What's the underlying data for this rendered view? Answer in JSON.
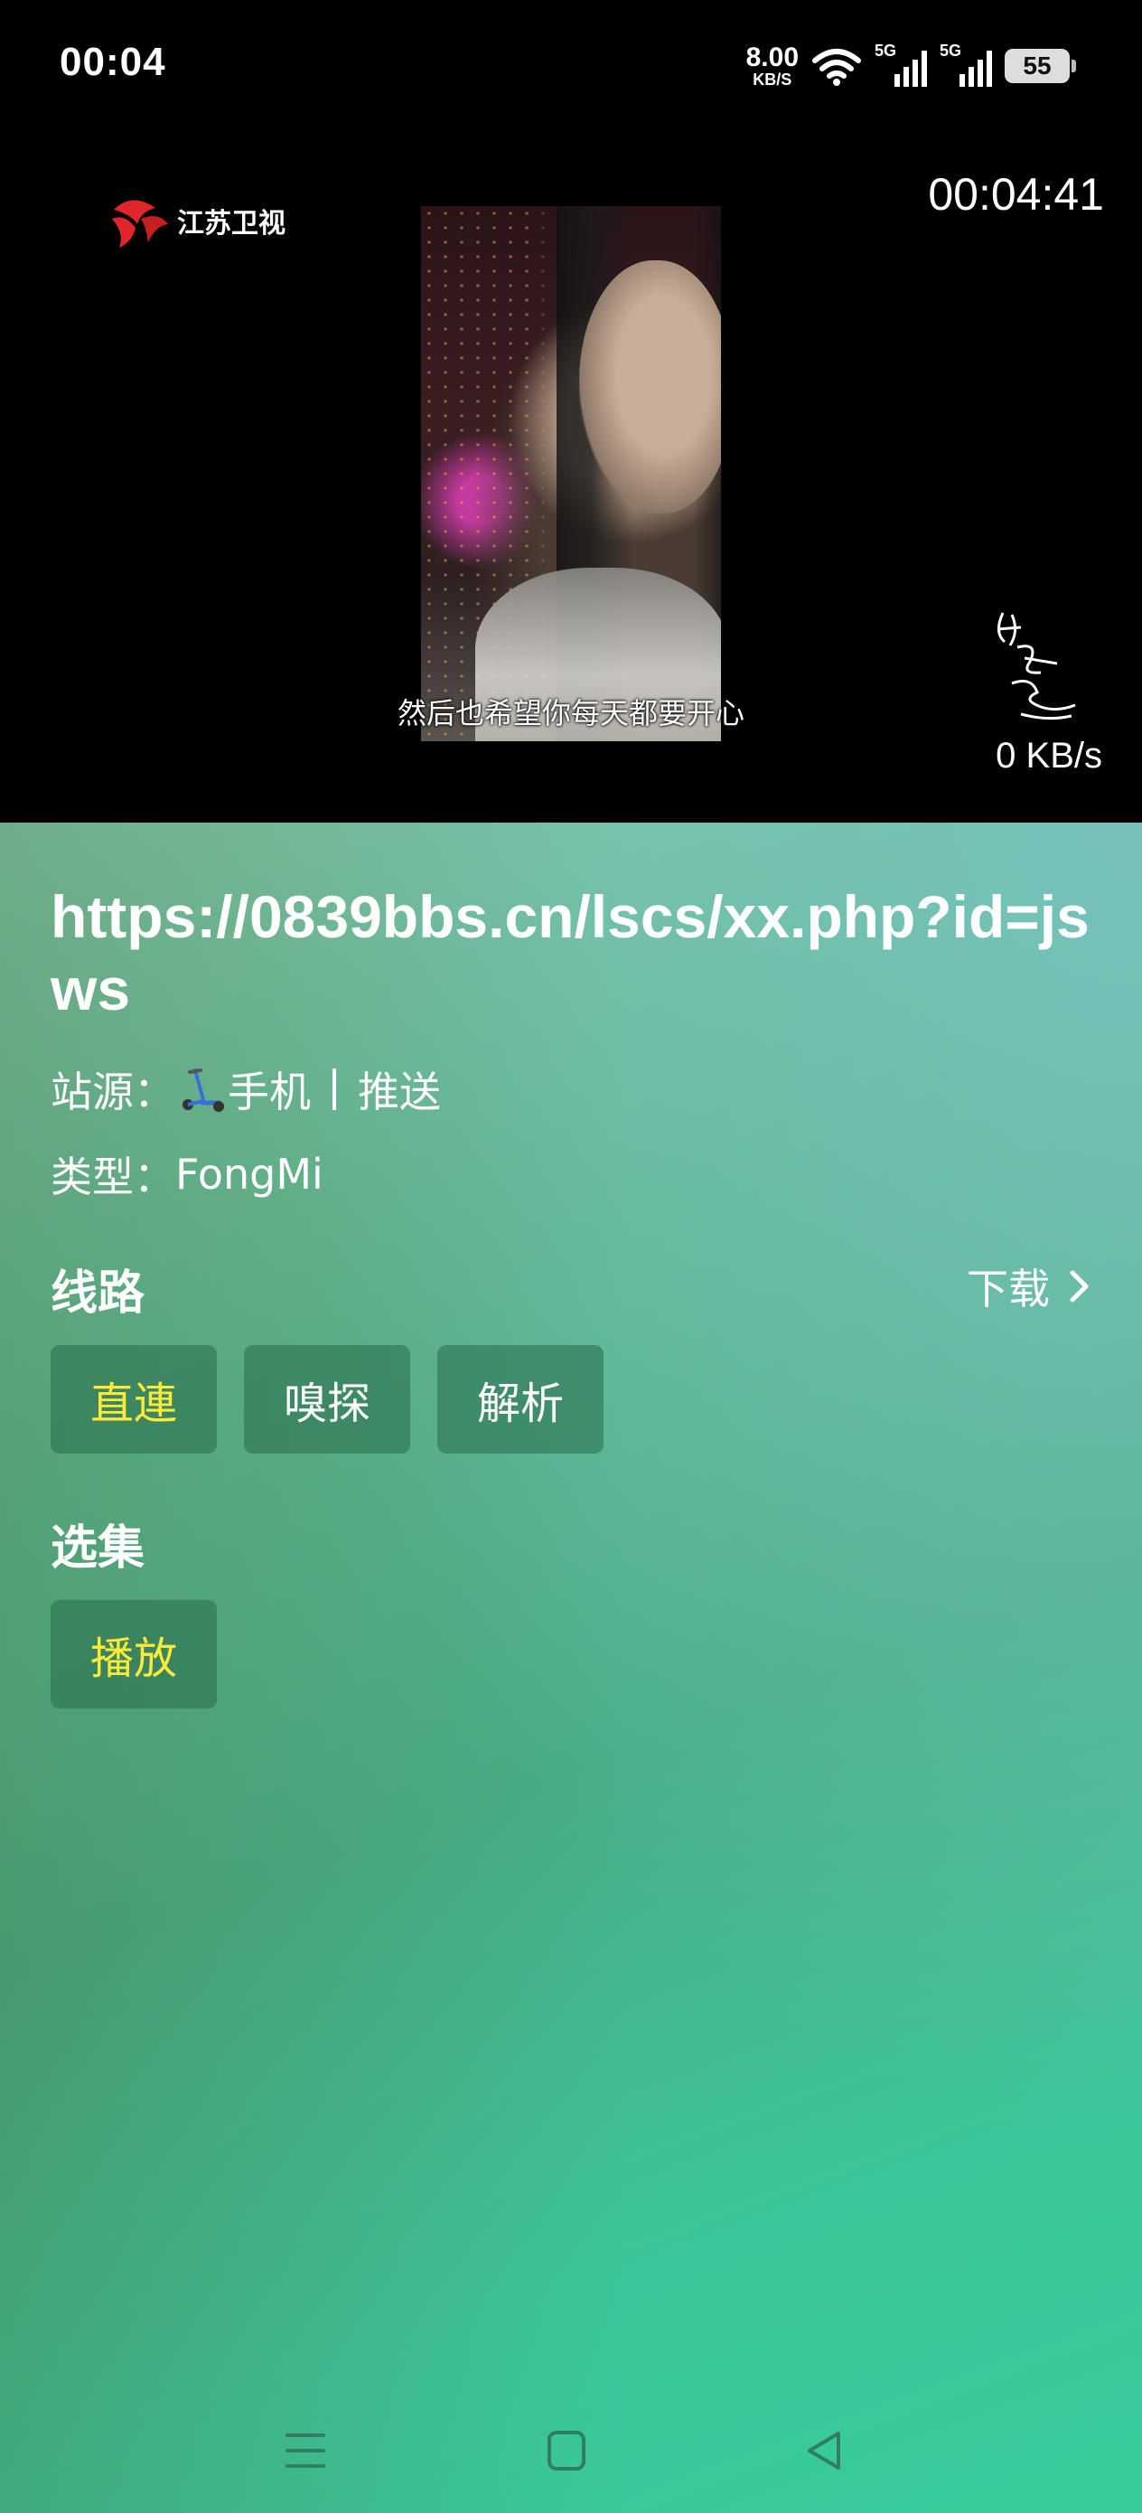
{
  "status_bar": {
    "time": "00:04",
    "net_speed_value": "8.00",
    "net_speed_unit": "KB/S",
    "sim1": "5G",
    "sim2": "5G",
    "battery": "55"
  },
  "player": {
    "channel_logo": "江苏卫视",
    "clock": "00:04:41",
    "subtitle": "然后也希望你每天都要开心",
    "speed": "0 KB/s"
  },
  "detail": {
    "title": "https://0839bbs.cn/lscs/xx.php?id=jsws",
    "source_label": "站源：",
    "source_icon": "scooter-icon",
    "source_value_1": "手机",
    "source_value_2": "推送",
    "type_label": "类型：",
    "type_value": "FongMi",
    "route_heading": "线路",
    "download_label": "下载",
    "routes": [
      "直連",
      "嗅探",
      "解析"
    ],
    "episodes_heading": "选集",
    "episodes": [
      "播放"
    ],
    "active_color": "#ffea3a"
  },
  "nav": {
    "menu_icon": "menu-icon",
    "home_icon": "home-icon",
    "back_icon": "back-icon"
  }
}
